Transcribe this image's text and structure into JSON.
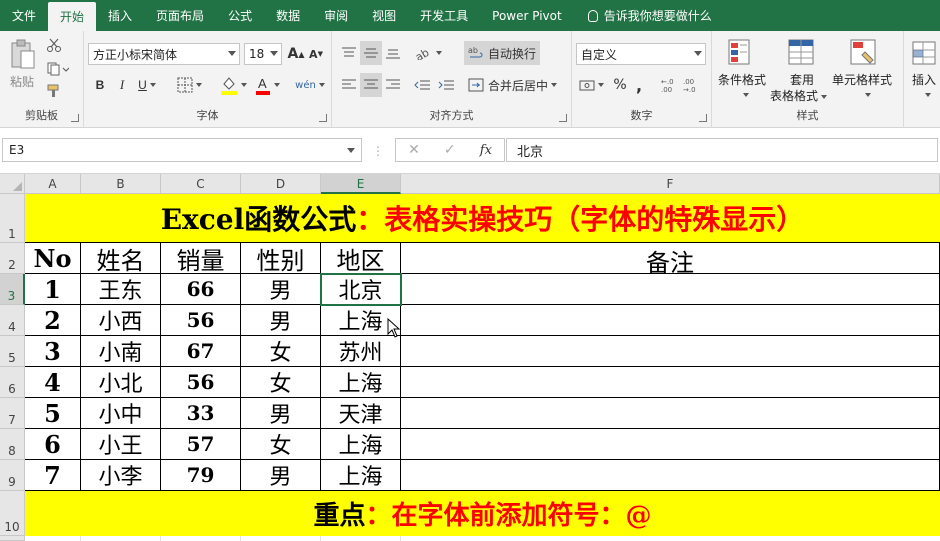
{
  "tabs": [
    "文件",
    "开始",
    "插入",
    "页面布局",
    "公式",
    "数据",
    "审阅",
    "视图",
    "开发工具",
    "Power Pivot"
  ],
  "active_tab": "开始",
  "tell_me": "告诉我你想要做什么",
  "ribbon": {
    "clipboard": {
      "paste_label": "粘贴",
      "group_label": "剪贴板"
    },
    "font": {
      "font_name": "方正小标宋简体",
      "font_size": "18",
      "group_label": "字体",
      "bold": "B",
      "italic": "I",
      "underline": "U",
      "grow": "A",
      "shrink": "A",
      "wen": "wén"
    },
    "alignment": {
      "wrap_text": "自动换行",
      "merge_center": "合并后居中",
      "group_label": "对齐方式"
    },
    "number": {
      "format": "自定义",
      "percent": "%",
      "comma": ",",
      "group_label": "数字"
    },
    "styles": {
      "conditional": "条件格式",
      "table_format_line1": "套用",
      "table_format_line2": "表格格式",
      "cell_styles": "单元格样式",
      "group_label": "样式"
    },
    "cells": {
      "insert": "插入"
    }
  },
  "formula_bar": {
    "name_box": "E3",
    "formula": "北京",
    "fx": "fx",
    "cancel": "✕",
    "enter": "✓"
  },
  "columns": [
    "A",
    "B",
    "C",
    "D",
    "E",
    "F"
  ],
  "selected_column": "E",
  "rows": [
    "1",
    "2",
    "3",
    "4",
    "5",
    "6",
    "7",
    "8",
    "9",
    "10"
  ],
  "selected_row": "3",
  "sheet": {
    "title_black": "Excel函数公式",
    "title_red": "：表格实操技巧（字体的特殊显示）",
    "headers": [
      "No",
      "姓名",
      "销量",
      "性别",
      "地区",
      "备注"
    ],
    "records": [
      [
        "1",
        "王东",
        "66",
        "男",
        "北京",
        ""
      ],
      [
        "2",
        "小西",
        "56",
        "男",
        "上海",
        ""
      ],
      [
        "3",
        "小南",
        "67",
        "女",
        "苏州",
        ""
      ],
      [
        "4",
        "小北",
        "56",
        "女",
        "上海",
        ""
      ],
      [
        "5",
        "小中",
        "33",
        "男",
        "天津",
        ""
      ],
      [
        "6",
        "小王",
        "57",
        "女",
        "上海",
        ""
      ],
      [
        "7",
        "小李",
        "79",
        "男",
        "上海",
        ""
      ]
    ],
    "footer_black": "重点",
    "footer_red": "：在字体前添加符号：@"
  },
  "colors": {
    "excel_green": "#217346",
    "banner_yellow": "#ffff00",
    "accent_red": "#ff0000"
  }
}
